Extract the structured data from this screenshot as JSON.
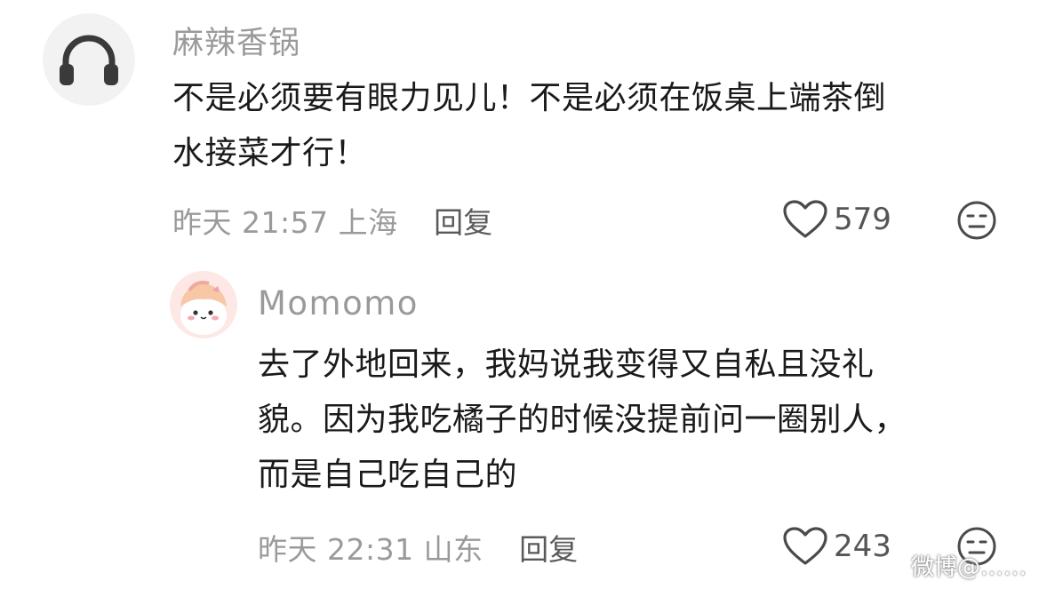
{
  "comments": [
    {
      "avatar_icon": "headphones-icon",
      "username": "麻辣香锅",
      "text_lines": [
        "不是必须要有眼力见儿！不是必须在饭桌上端茶倒",
        "水接菜才行！"
      ],
      "time": "昨天 21:57 上海",
      "reply_label": "回复",
      "likes": "579"
    },
    {
      "avatar_icon": "cute-pink-character-icon",
      "username": "Momomo",
      "text_lines": [
        "去了外地回来，我妈说我变得又自私且没礼",
        "貌。因为我吃橘子的时候没提前问一圈别人，",
        "而是自己吃自己的"
      ],
      "time": "昨天 22:31 山东",
      "reply_label": "回复",
      "likes": "243"
    }
  ],
  "watermark": "微博@……"
}
